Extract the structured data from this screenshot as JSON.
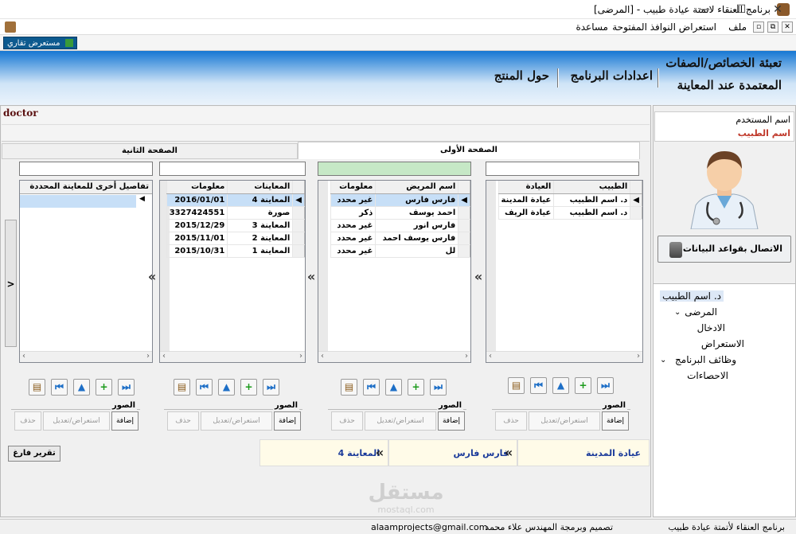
{
  "window": {
    "title": "برنامج العنقاء لاتمتة عيادة طبيب - [المرضى]",
    "controls": [
      "—",
      "☐",
      "✕"
    ]
  },
  "menu": {
    "items": [
      "ملف",
      "استعراض النوافذ المفتوحة",
      "مساعدة"
    ],
    "mdi_controls": [
      "▫",
      "⧉",
      "✕"
    ]
  },
  "toolbar": {
    "button_label": "مستعرض تقاري"
  },
  "banner": {
    "fill_attributes_line1": "تعبئة الخصائص/الصفات",
    "fill_attributes_line2": "المعتمدة عند المعاينة",
    "program_settings": "اعدادات البرنامج",
    "about_product": "حول المنتج"
  },
  "header_strip": {
    "doctor_label": "doctor"
  },
  "tabs": {
    "page1": "الصفحة الأولى",
    "page2": "الصفحة الثانية"
  },
  "clinics_grid": {
    "columns": [
      "الطبيب",
      "العيادة"
    ],
    "rows": [
      [
        "د. اسم الطبيب",
        "عيادة المدينة"
      ],
      [
        "د. اسم الطبيب",
        "عيادة الريف"
      ]
    ]
  },
  "patients_grid": {
    "columns": [
      "اسم المريض",
      "معلومات"
    ],
    "rows": [
      [
        "فارس فارس",
        "غير محدد"
      ],
      [
        "احمد يوسف",
        "ذكر"
      ],
      [
        "فارس انور",
        "غير محدد"
      ],
      [
        "فارس يوسف احمد",
        "غير محدد"
      ],
      [
        "لل",
        "غير محدد"
      ]
    ]
  },
  "exams_grid": {
    "columns": [
      "المعاينات",
      "معلومات"
    ],
    "rows": [
      [
        "المعاينة 4",
        "2016/01/01"
      ],
      [
        "صورة",
        "3327424551"
      ],
      [
        "المعاينة 3",
        "2015/12/29"
      ],
      [
        "المعاينة 2",
        "2015/11/01"
      ],
      [
        "المعاينة 1",
        "2015/10/31"
      ]
    ]
  },
  "details_grid": {
    "columns": [
      "تفاصيل أخرى للمعاينة المحددة"
    ]
  },
  "photos": {
    "label": "الصور",
    "add": "إضافة",
    "view_edit": "استعراض/تعديل",
    "delete": "حذف"
  },
  "empty_report_button": "تقرير فارغ",
  "strip": {
    "clinic": "عيادة المدينة",
    "patient": "فارس فارس",
    "exam": "المعاينة 4"
  },
  "sidebar": {
    "username_label": "اسم المستخدم",
    "username_value": "اسم الطبيب",
    "connect_db_button": "الاتصال بقواعد البيانات"
  },
  "tree": {
    "root": "د. اسم الطبيب",
    "patients": "المرضى",
    "entry": "الادخال",
    "browse": "الاستعراض",
    "program_functions": "وظائف البرنامج",
    "statistics": "الاحصاءات"
  },
  "watermark": {
    "arabic": "مستقل",
    "latin": "mostaql.com"
  },
  "status": {
    "app_name": "برنامج العنقاء لأتمتة عيادة طبيب",
    "designer": "تصميم وبرمجة المهندس علاء محمد",
    "email": "alaamprojects@gmail.com"
  },
  "colors": {
    "banner_top": "#1577d3",
    "selection": "#c7dff7",
    "strip_text": "#1a3a9a",
    "username_value": "#c0392b"
  }
}
